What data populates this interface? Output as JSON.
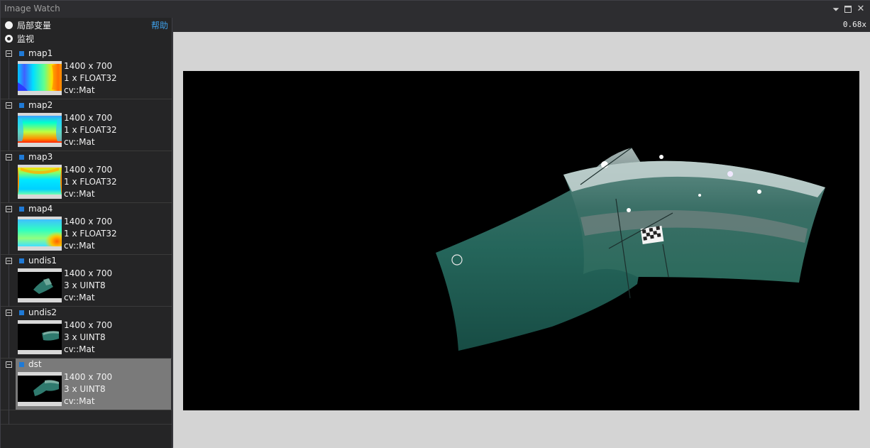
{
  "window": {
    "title": "Image Watch"
  },
  "title_controls": {
    "dropdown": "⏷",
    "maximize": "🗖",
    "close": "✕"
  },
  "modes": [
    {
      "label": "局部变量",
      "selected": false
    },
    {
      "label": "监视",
      "selected": true
    }
  ],
  "help": {
    "label": "帮助"
  },
  "viewer": {
    "zoom": "0.68x"
  },
  "colors": {
    "accent": "#1f7ad6",
    "link": "#3e9fe8",
    "selection": "#7a7a7a",
    "viewer_bg": "#d4d4d4"
  },
  "watch_items": [
    {
      "name": "map1",
      "dims": "1400 x 700",
      "channels": "1 x FLOAT32",
      "type": "cv::Mat",
      "thumb": "jet-map1-icon"
    },
    {
      "name": "map2",
      "dims": "1400 x 700",
      "channels": "1 x FLOAT32",
      "type": "cv::Mat",
      "thumb": "jet-map2-icon"
    },
    {
      "name": "map3",
      "dims": "1400 x 700",
      "channels": "1 x FLOAT32",
      "type": "cv::Mat",
      "thumb": "jet-map3-icon"
    },
    {
      "name": "map4",
      "dims": "1400 x 700",
      "channels": "1 x FLOAT32",
      "type": "cv::Mat",
      "thumb": "jet-map4-icon"
    },
    {
      "name": "undis1",
      "dims": "1400 x 700",
      "channels": "3 x UINT8",
      "type": "cv::Mat",
      "thumb": "undistorted-image-icon"
    },
    {
      "name": "undis2",
      "dims": "1400 x 700",
      "channels": "3 x UINT8",
      "type": "cv::Mat",
      "thumb": "undistorted-image-icon"
    },
    {
      "name": "dst",
      "dims": "1400 x 700",
      "channels": "3 x UINT8",
      "type": "cv::Mat",
      "thumb": "stitched-image-icon",
      "selected": true
    }
  ]
}
